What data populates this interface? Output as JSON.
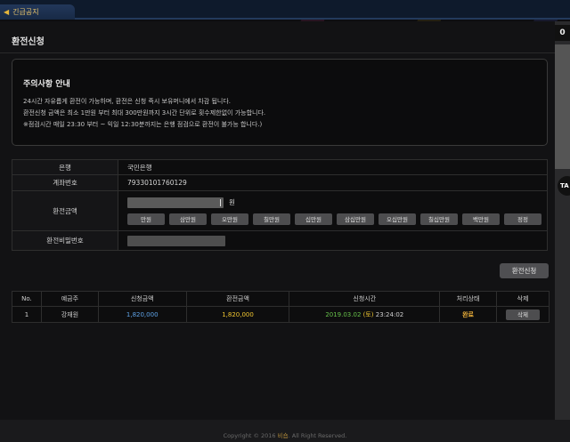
{
  "topbar": {
    "notice_label": "긴급공지"
  },
  "page": {
    "title": "환전신청"
  },
  "caution": {
    "title": "주의사항 안내",
    "lines": [
      "24시간 자유롭게 환전이 가능하며, 환전은 신청 즉시 보유머니에서 차감 됩니다.",
      "환전신청 금액은 최소 1만원 부터 최대 300만원까지 3시간 단위로 횟수제한없이 가능합니다.",
      "※점검시간 매일 23:30 부터 ~ 익일 12:30분까지는 은행 점검으로 환전이 불가능 합니다.)"
    ]
  },
  "form": {
    "bank_label": "은행",
    "bank_value": "국민은행",
    "account_label": "계좌번호",
    "account_value": "79330101760129",
    "amount_label": "환전금액",
    "amount_unit": "원",
    "chips": [
      "만원",
      "삼만원",
      "오만원",
      "칠만원",
      "십만원",
      "삼십만원",
      "오십만원",
      "칠십만원",
      "백만원",
      "정정"
    ],
    "password_label": "환전비밀번호"
  },
  "apply_button": "환전신청",
  "history": {
    "headers": [
      "No.",
      "예금주",
      "신청금액",
      "환전금액",
      "신청시간",
      "처리상태",
      "삭제"
    ],
    "rows": [
      {
        "no": "1",
        "holder": "강재원",
        "requested": "1,820,000",
        "exchanged": "1,820,000",
        "time_date": "2019.03.02",
        "time_day": "(토)",
        "time_clock": "23:24:02",
        "status": "완료",
        "delete_label": "삭제"
      }
    ]
  },
  "footer": {
    "prefix": "Copyright © 2016 ",
    "brand": "비숍",
    "suffix": ". All Right Reserved."
  },
  "side": {
    "badge": "0",
    "ta": "TA"
  },
  "colors": {
    "amount_blue": "#5fa3e8",
    "amount_yellow": "#f0c530",
    "date_green": "#67c24a",
    "status_orange": "#f0b23a"
  }
}
